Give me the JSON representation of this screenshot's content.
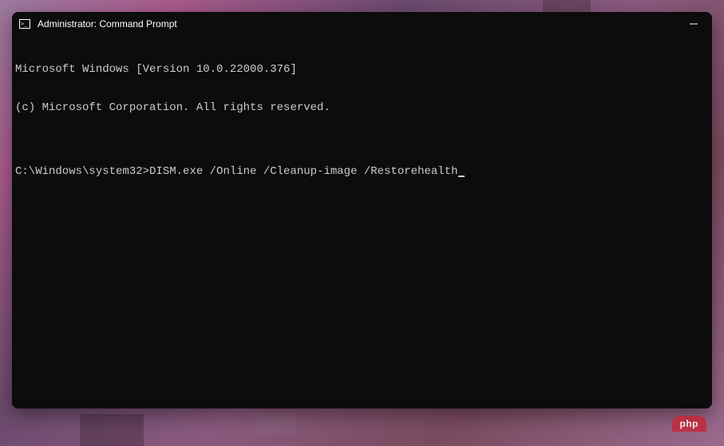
{
  "window": {
    "title": "Administrator: Command Prompt"
  },
  "terminal": {
    "line1": "Microsoft Windows [Version 10.0.22000.376]",
    "line2": "(c) Microsoft Corporation. All rights reserved.",
    "blank": "",
    "prompt": "C:\\Windows\\system32>",
    "command": "DISM.exe /Online /Cleanup-image /Restorehealth"
  },
  "watermark": "php"
}
